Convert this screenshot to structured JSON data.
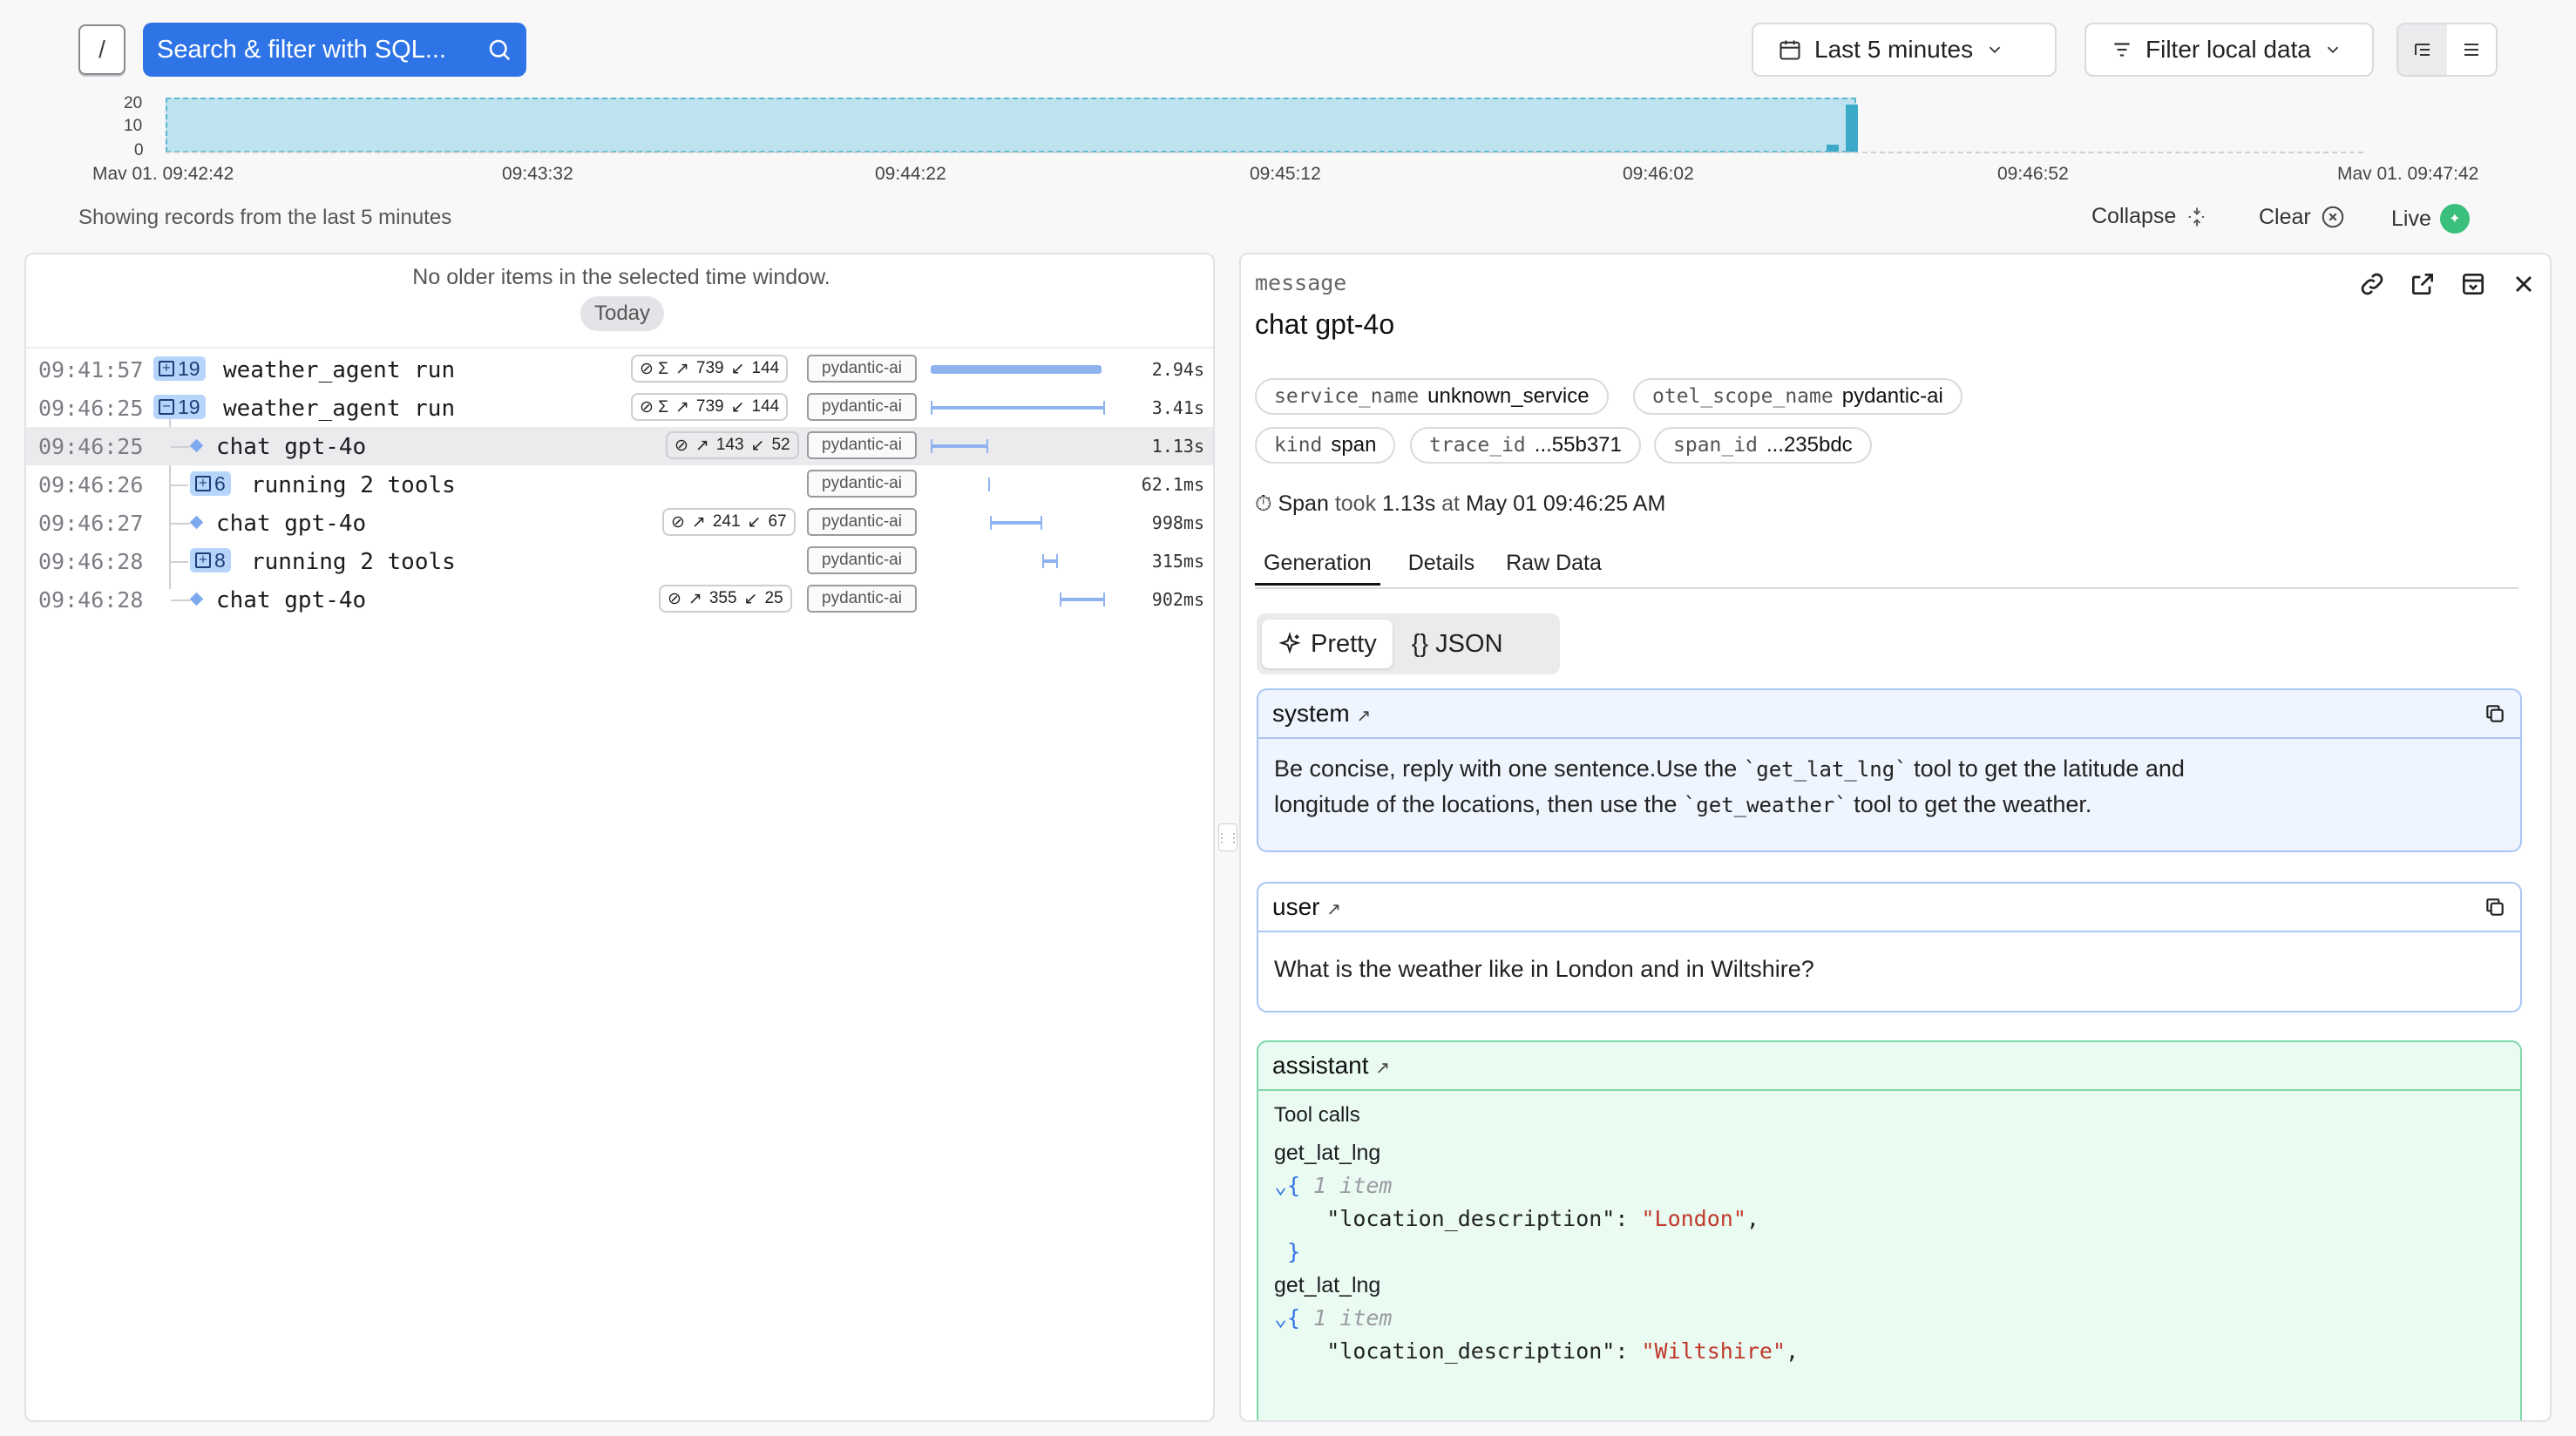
{
  "toolbar": {
    "slash_key": "/",
    "search_label": "Search & filter with SQL...",
    "time_range_label": "Last 5 minutes",
    "filter_label": "Filter local data"
  },
  "histogram": {
    "y_ticks": [
      "20",
      "10",
      "0"
    ],
    "x_ticks": [
      "Mav 01. 09:42:42",
      "09:43:32",
      "09:44:22",
      "09:45:12",
      "09:46:02",
      "09:46:52",
      "Mav 01. 09:47:42"
    ]
  },
  "status": {
    "showing_text": "Showing records from the last 5 minutes",
    "collapse_label": "Collapse",
    "clear_label": "Clear",
    "live_label": "Live"
  },
  "trace_list": {
    "no_older_text": "No older items in the selected time window.",
    "today_label": "Today",
    "rows": [
      {
        "time": "09:41:57",
        "count": "19",
        "name": "weather_agent run",
        "tokens_in": "739",
        "tokens_out": "144",
        "tag": "pydantic-ai",
        "duration": "2.94s"
      },
      {
        "time": "09:46:25",
        "count": "19",
        "name": "weather_agent run",
        "tokens_in": "739",
        "tokens_out": "144",
        "tag": "pydantic-ai",
        "duration": "3.41s"
      },
      {
        "time": "09:46:25",
        "name": "chat gpt-4o",
        "tokens_in": "143",
        "tokens_out": "52",
        "tag": "pydantic-ai",
        "duration": "1.13s"
      },
      {
        "time": "09:46:26",
        "count": "6",
        "name": "running 2 tools",
        "tag": "pydantic-ai",
        "duration": "62.1ms"
      },
      {
        "time": "09:46:27",
        "name": "chat gpt-4o",
        "tokens_in": "241",
        "tokens_out": "67",
        "tag": "pydantic-ai",
        "duration": "998ms"
      },
      {
        "time": "09:46:28",
        "count": "8",
        "name": "running 2 tools",
        "tag": "pydantic-ai",
        "duration": "315ms"
      },
      {
        "time": "09:46:28",
        "name": "chat gpt-4o",
        "tokens_in": "355",
        "tokens_out": "25",
        "tag": "pydantic-ai",
        "duration": "902ms"
      }
    ]
  },
  "details": {
    "label": "message",
    "title": "chat gpt-4o",
    "attrs": {
      "service_name_key": "service_name",
      "service_name_val": "unknown_service",
      "otel_scope_key": "otel_scope_name",
      "otel_scope_val": "pydantic-ai",
      "kind_key": "kind",
      "kind_val": "span",
      "trace_key": "trace_id",
      "trace_val": "...55b371",
      "span_key": "span_id",
      "span_val": "...235bdc"
    },
    "span_prefix": "Span",
    "span_took": "took",
    "span_duration": "1.13s",
    "span_at": "at",
    "span_time": "May 01 09:46:25 AM",
    "tabs": [
      "Generation",
      "Details",
      "Raw Data"
    ],
    "view_pretty": "Pretty",
    "view_json": "{} JSON",
    "system": {
      "role": "system",
      "text_1": "Be concise, reply with one sentence.Use the ",
      "code_1": "`get_lat_lng`",
      "text_2": " tool to get the latitude and",
      "text_3": "longitude of the locations, then use the ",
      "code_2": "`get_weather`",
      "text_4": " tool to get the weather."
    },
    "user": {
      "role": "user",
      "text": "What is the weather like in London and in Wiltshire?"
    },
    "assistant": {
      "role": "assistant",
      "tool_calls_label": "Tool calls",
      "calls": [
        {
          "name": "get_lat_lng",
          "item_count": "1 item",
          "key": "\"location_description\"",
          "value": "\"London\""
        },
        {
          "name": "get_lat_lng",
          "item_count": "1 item",
          "key": "\"location_description\"",
          "value": "\"Wiltshire\""
        }
      ]
    }
  },
  "colors": {
    "accent": "#2e74e6",
    "live": "#3bbf7c",
    "histogram_fill": "#bfe3ee",
    "badge": "#b7d4fb"
  }
}
